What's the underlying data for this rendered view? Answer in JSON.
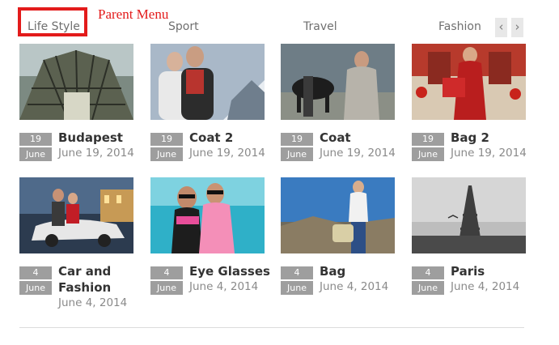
{
  "annotation": {
    "label": "Parent Menu"
  },
  "tabs": [
    {
      "label": "Life Style"
    },
    {
      "label": "Sport"
    },
    {
      "label": "Travel"
    },
    {
      "label": "Fashion"
    }
  ],
  "nav": {
    "prev": "‹",
    "next": "›"
  },
  "articles": [
    {
      "title": "Budapest",
      "day": "19",
      "month": "June",
      "date": "June 19, 2014"
    },
    {
      "title": "Coat 2",
      "day": "19",
      "month": "June",
      "date": "June 19, 2014"
    },
    {
      "title": "Coat",
      "day": "19",
      "month": "June",
      "date": "June 19, 2014"
    },
    {
      "title": "Bag 2",
      "day": "19",
      "month": "June",
      "date": "June 19, 2014"
    },
    {
      "title": "Car and Fashion",
      "day": "4",
      "month": "June",
      "date": "June 4, 2014"
    },
    {
      "title": "Eye Glasses",
      "day": "4",
      "month": "June",
      "date": "June 4, 2014"
    },
    {
      "title": "Bag",
      "day": "4",
      "month": "June",
      "date": "June 4, 2014"
    },
    {
      "title": "Paris",
      "day": "4",
      "month": "June",
      "date": "June 4, 2014"
    }
  ]
}
